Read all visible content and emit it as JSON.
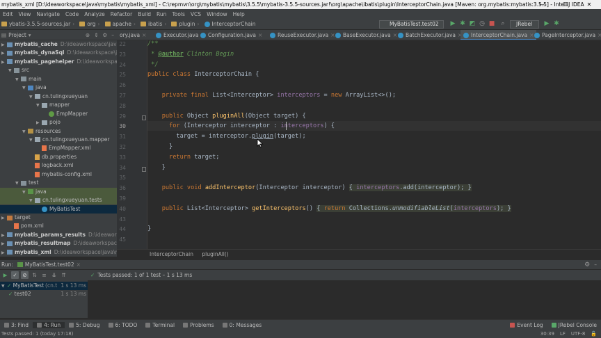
{
  "window": {
    "title": "mybatis_xml [D:\\ideaworkspace\\java\\mybatis\\mybatis_xml] - C:\\repmvn\\org\\mybatis\\mybatis\\3.5.5\\mybatis-3.5.5-sources.jar!\\org\\apache\\ibatis\\plugin\\InterceptorChain.java [Maven: org.mybatis:mybatis:3.5.5] - IntelliJ IDEA",
    "controls": [
      "—",
      "☐",
      "✕"
    ]
  },
  "menu": [
    "Edit",
    "View",
    "Navigate",
    "Code",
    "Analyze",
    "Refactor",
    "Build",
    "Run",
    "Tools",
    "VCS",
    "Window",
    "Help"
  ],
  "breadcrumbs": [
    "ybatis-3.5.5-sources.jar",
    "org",
    "apache",
    "ibatis",
    "plugin",
    "InterceptorChain"
  ],
  "toolbar": {
    "run_config": "MyBatisTest.test02",
    "jrebel": "JRebel"
  },
  "project_panel": {
    "title": "Project",
    "items": [
      {
        "label": "mybatis_cache",
        "path": "D:\\ideaworkspace\\java\\mybat",
        "indent": 0,
        "arrow": "▶",
        "icon": "module",
        "bold": true
      },
      {
        "label": "mybatis_dynaSql",
        "path": "D:\\ideaworkspace\\java\\myba",
        "indent": 0,
        "arrow": "▶",
        "icon": "module",
        "bold": true
      },
      {
        "label": "mybatis_pagehelper",
        "path": "D:\\ideaworkspace\\java\\m",
        "indent": 0,
        "arrow": "▶",
        "icon": "module",
        "bold": true
      },
      {
        "label": "src",
        "path": "",
        "indent": 1,
        "arrow": "▼",
        "icon": "folder",
        "bold": false
      },
      {
        "label": "main",
        "path": "",
        "indent": 2,
        "arrow": "▼",
        "icon": "folder",
        "bold": false
      },
      {
        "label": "java",
        "path": "",
        "indent": 3,
        "arrow": "▼",
        "icon": "source",
        "bold": false
      },
      {
        "label": "cn.tulingxueyuan",
        "path": "",
        "indent": 4,
        "arrow": "▼",
        "icon": "package",
        "bold": false
      },
      {
        "label": "mapper",
        "path": "",
        "indent": 5,
        "arrow": "▼",
        "icon": "package",
        "bold": false
      },
      {
        "label": "EmpMapper",
        "path": "",
        "indent": 6,
        "arrow": "",
        "icon": "interface",
        "bold": false
      },
      {
        "label": "pojo",
        "path": "",
        "indent": 5,
        "arrow": "▶",
        "icon": "package",
        "bold": false
      },
      {
        "label": "resources",
        "path": "",
        "indent": 3,
        "arrow": "▼",
        "icon": "resources",
        "bold": false
      },
      {
        "label": "cn.tulingxueyuan.mapper",
        "path": "",
        "indent": 4,
        "arrow": "▼",
        "icon": "package",
        "bold": false
      },
      {
        "label": "EmpMapper.xml",
        "path": "",
        "indent": 5,
        "arrow": "",
        "icon": "xml",
        "bold": false
      },
      {
        "label": "db.properties",
        "path": "",
        "indent": 4,
        "arrow": "",
        "icon": "file",
        "bold": false
      },
      {
        "label": "logback.xml",
        "path": "",
        "indent": 4,
        "arrow": "",
        "icon": "xml",
        "bold": false
      },
      {
        "label": "mybatis-config.xml",
        "path": "",
        "indent": 4,
        "arrow": "",
        "icon": "xml",
        "bold": false
      },
      {
        "label": "test",
        "path": "",
        "indent": 2,
        "arrow": "▼",
        "icon": "folder",
        "bold": false
      },
      {
        "label": "java",
        "path": "",
        "indent": 3,
        "arrow": "▼",
        "icon": "test",
        "bold": false,
        "state": "hl"
      },
      {
        "label": "cn.tulingxueyuan.tests",
        "path": "",
        "indent": 4,
        "arrow": "▼",
        "icon": "package",
        "bold": false,
        "state": "hl"
      },
      {
        "label": "MyBatisTest",
        "path": "",
        "indent": 5,
        "arrow": "",
        "icon": "class",
        "bold": false,
        "state": "sel"
      },
      {
        "label": "target",
        "path": "",
        "indent": 0,
        "arrow": "▶",
        "icon": "target",
        "bold": false
      },
      {
        "label": "pom.xml",
        "path": "",
        "indent": 1,
        "arrow": "",
        "icon": "xml",
        "bold": false
      },
      {
        "label": "mybatis_params_results",
        "path": "D:\\ideaworkspace\\",
        "indent": 0,
        "arrow": "▶",
        "icon": "module",
        "bold": true
      },
      {
        "label": "mybatis_resultmap",
        "path": "D:\\ideaworkspace\\java\\m",
        "indent": 0,
        "arrow": "▶",
        "icon": "module",
        "bold": true
      },
      {
        "label": "mybatis_xml",
        "path": "D:\\ideaworkspace\\java\\mybatis",
        "indent": 0,
        "arrow": "▶",
        "icon": "module",
        "bold": true
      }
    ]
  },
  "tabs": [
    {
      "label": "ory.java",
      "active": false
    },
    {
      "label": "Executor.java",
      "active": false
    },
    {
      "label": "Configuration.java",
      "active": false
    },
    {
      "label": "ReuseExecutor.java",
      "active": false
    },
    {
      "label": "BaseExecutor.java",
      "active": false
    },
    {
      "label": "BatchExecutor.java",
      "active": false
    },
    {
      "label": "InterceptorChain.java",
      "active": true
    },
    {
      "label": "PageInterceptor.java",
      "active": false
    }
  ],
  "editor": {
    "current_line": 30,
    "lines": [
      {
        "n": 22,
        "html": "<span class=\"cmt\">/**</span>"
      },
      {
        "n": 23,
        "html": "<span class=\"cmt\"> * </span><span class=\"tag\">@author</span><span class=\"cmt\"> Clinton Begin</span>"
      },
      {
        "n": 24,
        "html": "<span class=\"cmt\"> */</span>"
      },
      {
        "n": 25,
        "html": "<span class=\"kw\">public class</span> InterceptorChain {"
      },
      {
        "n": 26,
        "html": ""
      },
      {
        "n": 27,
        "html": "    <span class=\"kw\">private final</span> List&lt;Interceptor&gt; <span class=\"fld\">interceptors</span> = <span class=\"kw\">new</span> ArrayList&lt;&gt;();"
      },
      {
        "n": 28,
        "html": ""
      },
      {
        "n": 29,
        "html": "    <span class=\"kw\">public</span> Object <span class=\"fn\">pluginAll</span>(Object target) {"
      },
      {
        "n": 30,
        "html": "      <span class=\"kw\">for</span> (Interceptor interceptor : <span class=\"fld\">interceptors</span>) {"
      },
      {
        "n": 31,
        "html": "        target = interceptor.<span class=\"und\">plugin</span>(target);"
      },
      {
        "n": 32,
        "html": "      }"
      },
      {
        "n": 33,
        "html": "      <span class=\"kw\">return</span> target;"
      },
      {
        "n": 34,
        "html": "    }"
      },
      {
        "n": 35,
        "html": ""
      },
      {
        "n": 36,
        "html": "    <span class=\"kw\">public void</span> <span class=\"fn\">addInterceptor</span>(Interceptor interceptor) <span class=\"fold-bg\">{ <span class=\"fld\">interceptors</span>.add(interceptor); }</span>"
      },
      {
        "n": 39,
        "html": ""
      },
      {
        "n": 40,
        "html": "    <span class=\"kw\">public</span> List&lt;Interceptor&gt; <span class=\"fn\">getInterceptors</span>() <span class=\"fold-bg\">{ <span class=\"kw\">return</span> Collections.<span class=\"it\">unmodifiableList</span>(<span class=\"fld\">interceptors</span>); }</span>"
      },
      {
        "n": 43,
        "html": ""
      },
      {
        "n": 44,
        "html": "}"
      },
      {
        "n": 45,
        "html": ""
      }
    ],
    "breadcrumbs": [
      "InterceptorChain",
      "pluginAll()"
    ]
  },
  "run_panel": {
    "label": "Run:",
    "config": "MyBatisTest.test02",
    "status_text": "Tests passed: 1 of 1 test – 1 s 13 ms",
    "tree": [
      {
        "label": "MyBatisTest",
        "detail": "(cn.t",
        "time": "1 s 13 ms",
        "indent": 0
      },
      {
        "label": "test02",
        "detail": "",
        "time": "1 s 13 ms",
        "indent": 1
      }
    ]
  },
  "tool_windows": {
    "left": [
      "3: Find",
      "4: Run",
      "5: Debug",
      "6: TODO",
      "Terminal",
      "Problems",
      "0: Messages"
    ],
    "right": [
      "Event Log",
      "JRebel Console"
    ]
  },
  "statusbar": {
    "left": "Tests passed: 1 (today 17:18)",
    "position": "30:39",
    "line_sep": "LF",
    "encoding": "UTF-8"
  },
  "colors": {
    "accent": "#4a88c7",
    "keyword": "#cc7832",
    "field": "#9876aa",
    "method": "#ffc66d",
    "comment": "#629755",
    "success": "#59a869"
  }
}
